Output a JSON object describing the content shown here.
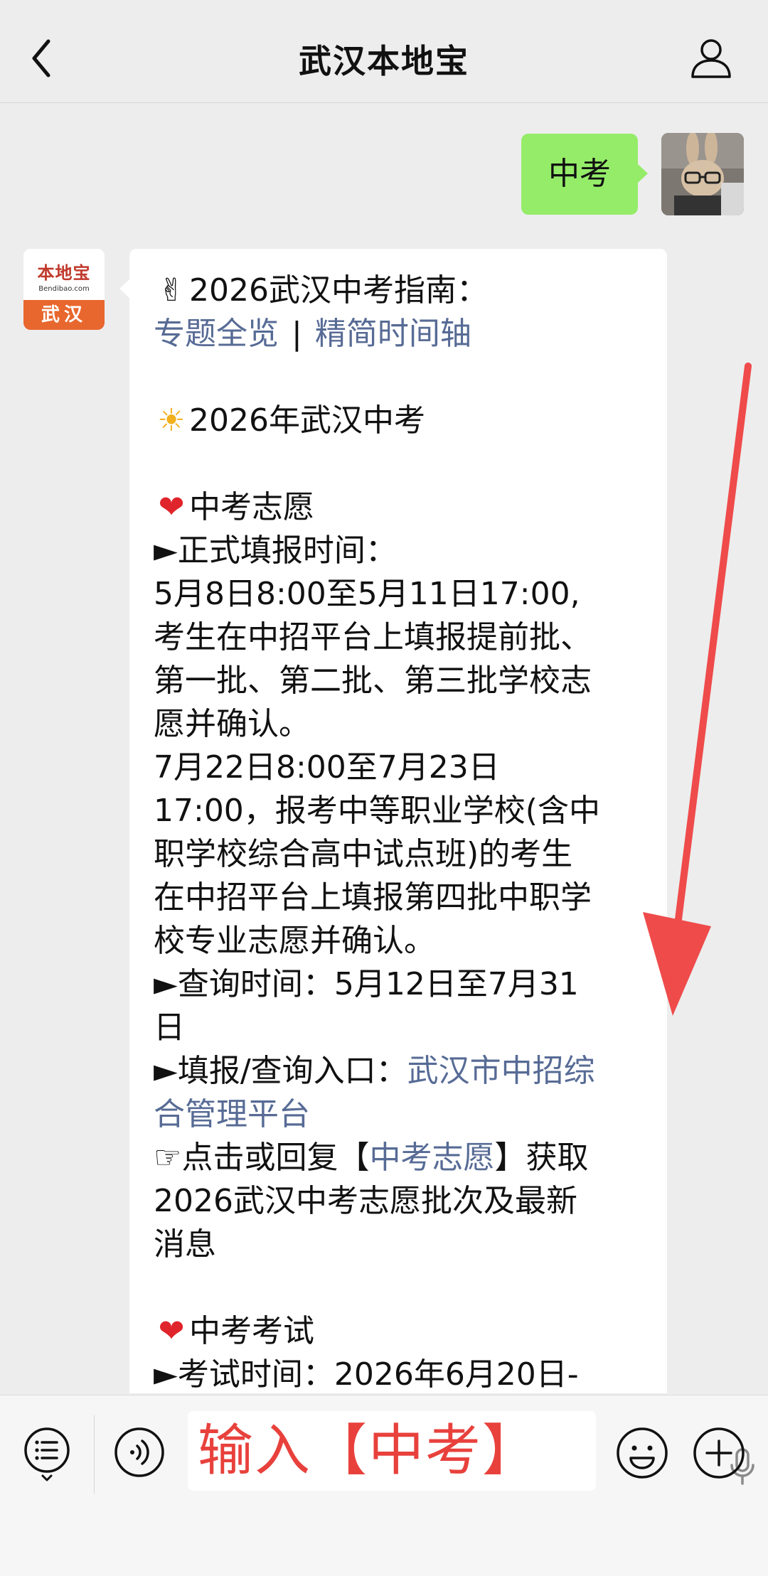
{
  "header": {
    "title": "武汉本地宝"
  },
  "chat": {
    "outgoing_text": "中考",
    "bot_logo": {
      "name": "本地宝",
      "url": "Bendibao.com",
      "city": "武汉"
    },
    "incoming": {
      "l1_emoji": "✌",
      "l1_text": "2026武汉中考指南：",
      "l2_link1": "专题全览",
      "l2_sep": "|",
      "l2_link2": "精简时间轴",
      "l4_emoji": "☀",
      "l4_text": "2026年武汉中考",
      "l6_emoji": "❤",
      "l6_text": "中考志愿",
      "l7": "►正式填报时间：",
      "l8": "5月8日8:00至5月11日17:00,",
      "l9": "考生在中招平台上填报提前批、",
      "l10": "第一批、第二批、第三批学校志",
      "l11": "愿并确认。",
      "l12": "7月22日8:00至7月23日",
      "l13": "17:00，报考中等职业学校(含中",
      "l14": "职学校综合高中试点班)的考生",
      "l15": "在中招平台上填报第四批中职学",
      "l16": "校专业志愿并确认。",
      "l17": "►查询时间：5月12日至7月31",
      "l18": "日",
      "l19_prefix": "►填报/查询入口：",
      "l19_link": "武汉市中招综",
      "l20_link": "合管理平台",
      "l21_prefix": "☞点击或回复【",
      "l21_link": "中考志愿",
      "l21_suffix": "】获取",
      "l22": "2026武汉中考志愿批次及最新",
      "l23": "消息",
      "l25_emoji": "❤",
      "l25_text": "中考考试",
      "l26": "►考试时间：2026年6月20日-"
    }
  },
  "input_bar": {
    "text": "输入【中考】"
  },
  "colors": {
    "link": "#576b95",
    "outgoing_bubble": "#95ec69",
    "annotation_red": "#e8413c",
    "background": "#ededed"
  },
  "icons": [
    "back-arrow-icon",
    "profile-icon",
    "menu-list-icon",
    "voice-icon",
    "microphone-icon",
    "emoji-icon",
    "plus-icon"
  ]
}
